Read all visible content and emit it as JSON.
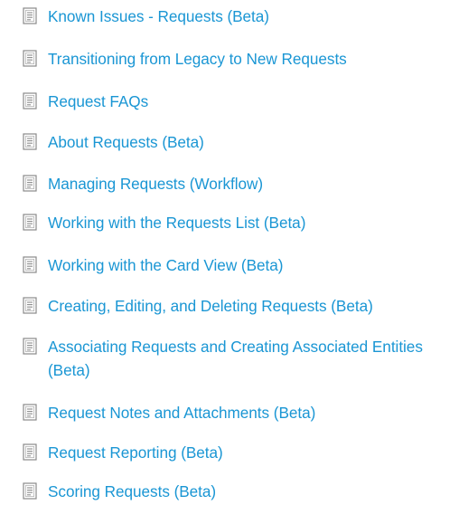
{
  "icon": "document-icon",
  "colors": {
    "link": "#1a96d4",
    "icon_stroke": "#8a8a8a"
  },
  "articles": [
    {
      "label": "Known Issues - Requests (Beta)"
    },
    {
      "label": "Transitioning from Legacy to New Requests"
    },
    {
      "label": "Request FAQs"
    },
    {
      "label": "About Requests (Beta)"
    },
    {
      "label": "Managing Requests (Workflow)"
    },
    {
      "label": "Working with the Requests List (Beta)"
    },
    {
      "label": "Working with the Card View (Beta)"
    },
    {
      "label": "Creating, Editing, and Deleting Requests (Beta)"
    },
    {
      "label": "Associating Requests and Creating Associated Entities (Beta)"
    },
    {
      "label": "Request Notes and Attachments (Beta)"
    },
    {
      "label": "Request Reporting (Beta)"
    },
    {
      "label": "Scoring Requests (Beta)"
    }
  ]
}
